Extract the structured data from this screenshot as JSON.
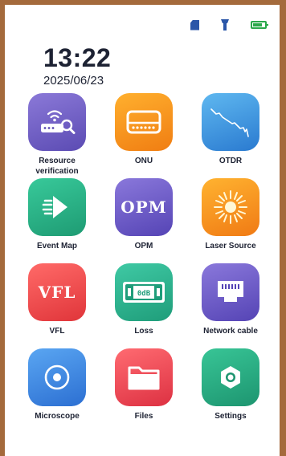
{
  "status_bar": {
    "icons": [
      "sd-card-icon",
      "flashlight-icon",
      "battery-icon"
    ],
    "accent_colors": {
      "sd": "#2a56a8",
      "flashlight": "#2a56a8",
      "battery": "#2aa84a"
    }
  },
  "header": {
    "time": "13:22",
    "date": "2025/06/23"
  },
  "apps": [
    {
      "label": "Resource\nverification",
      "icon": "router-search-icon"
    },
    {
      "label": "ONU",
      "icon": "onu-device-icon"
    },
    {
      "label": "OTDR",
      "icon": "otdr-trace-icon"
    },
    {
      "label": "Event Map",
      "icon": "event-map-icon"
    },
    {
      "label": "OPM",
      "icon": "opm-text-icon",
      "icon_text": "OPM"
    },
    {
      "label": "Laser Source",
      "icon": "laser-burst-icon"
    },
    {
      "label": "VFL",
      "icon": "vfl-text-icon",
      "icon_text": "VFL"
    },
    {
      "label": "Loss",
      "icon": "loss-meter-icon",
      "icon_text": "0dB"
    },
    {
      "label": "Network cable",
      "icon": "ethernet-port-icon"
    },
    {
      "label": "Microscope",
      "icon": "microscope-target-icon"
    },
    {
      "label": "Files",
      "icon": "folder-icon"
    },
    {
      "label": "Settings",
      "icon": "gear-icon"
    }
  ]
}
